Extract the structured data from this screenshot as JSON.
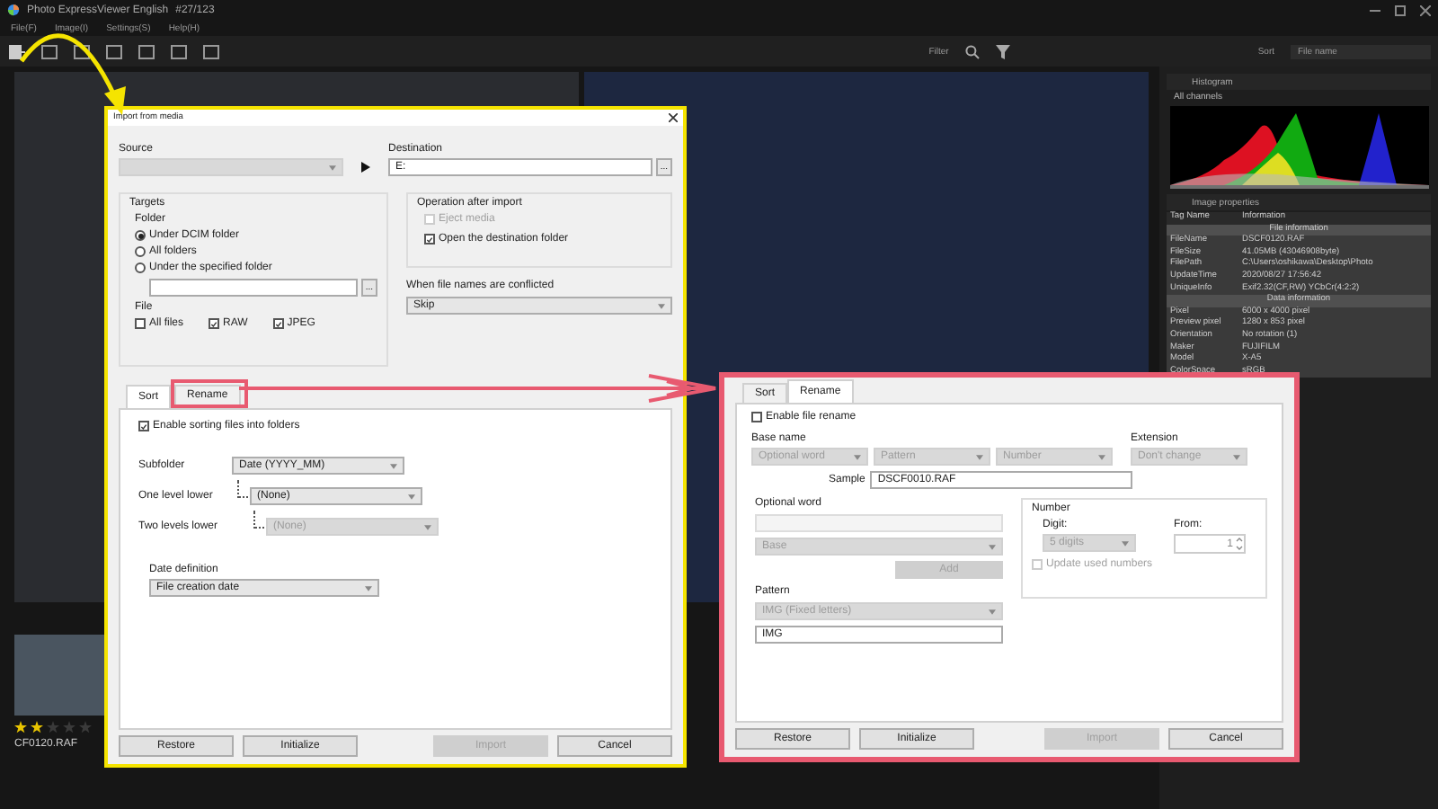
{
  "app": {
    "title": "Photo ExpressViewer English",
    "counter": "#27/123",
    "menu": [
      "File(F)",
      "Image(I)",
      "Settings(S)",
      "Help(H)"
    ],
    "filter_label": "Filter",
    "sort_label": "Sort",
    "sort_value": "File name"
  },
  "side_panel": {
    "histogram": {
      "title": "Histogram",
      "channel": "All channels"
    },
    "properties": {
      "title": "Image properties",
      "columns": [
        "Tag Name",
        "Information"
      ],
      "sections": [
        {
          "title": "File information",
          "rows": [
            {
              "tag": "FileName",
              "info": "DSCF0120.RAF"
            },
            {
              "tag": "FileSize",
              "info": "41.05MB (43046908byte)"
            },
            {
              "tag": "FilePath",
              "info": "C:\\Users\\oshikawa\\Desktop\\Photo"
            },
            {
              "tag": "UpdateTime",
              "info": "2020/08/27 17:56:42"
            },
            {
              "tag": "UniqueInfo",
              "info": "Exif2.32(CF,RW) YCbCr(4:2:2)"
            }
          ]
        },
        {
          "title": "Data information",
          "rows": [
            {
              "tag": "Pixel",
              "info": "6000 x 4000 pixel"
            },
            {
              "tag": "Preview pixel",
              "info": "1280 x 853 pixel"
            },
            {
              "tag": "Orientation",
              "info": "No rotation (1)"
            },
            {
              "tag": "Maker",
              "info": "FUJIFILM"
            },
            {
              "tag": "Model",
              "info": "X-A5"
            },
            {
              "tag": "ColorSpace",
              "info": "sRGB"
            }
          ]
        }
      ]
    }
  },
  "filmstrip": [
    {
      "filename": "CF0120.RAF",
      "stars": 2
    }
  ],
  "import_dialog": {
    "title": "Import from media",
    "source_label": "Source",
    "destination_label": "Destination",
    "destination_value": "E:",
    "browse": "...",
    "targets": {
      "title": "Targets",
      "folder_label": "Folder",
      "folder_options": [
        {
          "label": "Under DCIM folder",
          "selected": true
        },
        {
          "label": "All folders",
          "selected": false
        },
        {
          "label": "Under the specified folder",
          "selected": false
        }
      ],
      "browse": "...",
      "file_label": "File",
      "file_types": [
        {
          "label": "All files",
          "checked": false
        },
        {
          "label": "RAW",
          "checked": true
        },
        {
          "label": "JPEG",
          "checked": true
        }
      ]
    },
    "after_import": {
      "title": "Operation after import",
      "options": [
        {
          "label": "Eject media",
          "checked": false,
          "disabled": true
        },
        {
          "label": "Open the destination folder",
          "checked": true,
          "disabled": false
        }
      ]
    },
    "conflict_label": "When file names are conflicted",
    "conflict_value": "Skip",
    "tabs": [
      {
        "label": "Sort",
        "selected": true,
        "highlighted": false
      },
      {
        "label": "Rename",
        "selected": false,
        "highlighted": true
      }
    ],
    "sort": {
      "enable_label": "Enable sorting files into folders",
      "enable_checked": true,
      "subfolders": [
        {
          "label": "Subfolder",
          "value": "Date (YYYY_MM)",
          "disabled": false,
          "children": [
            {
              "label": "One level lower",
              "value": "(None)",
              "disabled": false,
              "children": [
                {
                  "label": "Two levels lower",
                  "value": "(None)",
                  "disabled": true
                }
              ]
            }
          ]
        }
      ],
      "date_label": "Date definition",
      "date_value": "File creation date"
    },
    "buttons": [
      {
        "label": "Restore",
        "disabled": false
      },
      {
        "label": "Initialize",
        "disabled": false
      },
      {
        "label": "Import",
        "disabled": true
      },
      {
        "label": "Cancel",
        "disabled": false
      }
    ]
  },
  "rename_inset": {
    "tabs": [
      {
        "label": "Sort",
        "selected": false
      },
      {
        "label": "Rename",
        "selected": true
      }
    ],
    "enable_label": "Enable file rename",
    "enable_checked": false,
    "base_name_label": "Base name",
    "base_parts": [
      "Optional word",
      "Pattern",
      "Number"
    ],
    "extension_label": "Extension",
    "extension_value": "Don't change",
    "sample_label": "Sample",
    "sample_value": "DSCF0010.RAF",
    "optional_word": {
      "title": "Optional word",
      "base_value": "Base",
      "add_button": "Add"
    },
    "pattern": {
      "title": "Pattern",
      "value": "IMG (Fixed letters)",
      "text": "IMG"
    },
    "number": {
      "title": "Number",
      "digit_label": "Digit:",
      "digit_value": "5 digits",
      "from_label": "From:",
      "from_value": "1",
      "update_label": "Update used numbers",
      "update_checked": false
    },
    "buttons": [
      {
        "label": "Restore",
        "disabled": false
      },
      {
        "label": "Initialize",
        "disabled": false
      },
      {
        "label": "Import",
        "disabled": true
      },
      {
        "label": "Cancel",
        "disabled": false
      }
    ]
  }
}
